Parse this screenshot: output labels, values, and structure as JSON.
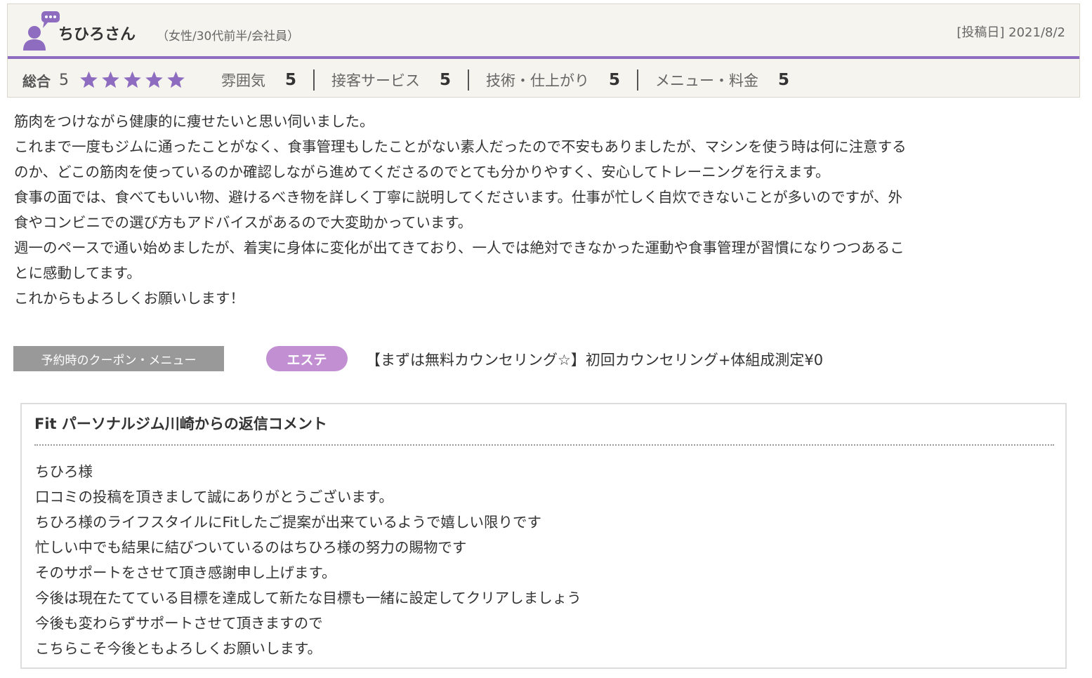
{
  "review": {
    "nickname": "ちひろさん",
    "profile": "（女性/30代前半/会社員）",
    "post_date": "[投稿日] 2021/8/2",
    "overall_label": "総合",
    "overall_value": "5",
    "overall_stars": 5,
    "categories": [
      {
        "label": "雰囲気",
        "value": "5"
      },
      {
        "label": "接客サービス",
        "value": "5"
      },
      {
        "label": "技術・仕上がり",
        "value": "5"
      },
      {
        "label": "メニュー・料金",
        "value": "5"
      }
    ],
    "body_lines": [
      "筋肉をつけながら健康的に痩せたいと思い伺いました。",
      "これまで一度もジムに通ったことがなく、食事管理もしたことがない素人だったので不安もありましたが、マシンを使う時は何に注意する",
      "のか、どこの筋肉を使っているのか確認しながら進めてくださるのでとても分かりやすく、安心してトレーニングを行えます。",
      "食事の面では、食べてもいい物、避けるべき物を詳しく丁寧に説明してくださいます。仕事が忙しく自炊できないことが多いのですが、外",
      "食やコンビニでの選び方もアドバイスがあるので大変助かっています。",
      "週一のペースで通い始めましたが、着実に身体に変化が出てきており、一人では絶対できなかった運動や食事管理が習慣になりつつあるこ",
      "とに感動してます。",
      "これからもよろしくお願いします！"
    ]
  },
  "coupon": {
    "label": "予約時のクーポン・メニュー",
    "genre": "エステ",
    "name": "【まずは無料カウンセリング☆】初回カウンセリング+体組成測定¥0"
  },
  "reply": {
    "title": "Fit パーソナルジム川崎からの返信コメント",
    "lines": [
      "ちひろ様",
      "口コミの投稿を頂きまして誠にありがとうございます。",
      "ちひろ様のライフスタイルにFitしたご提案が出来ているようで嬉しい限りです",
      "忙しい中でも結果に結びついているのはちひろ様の努力の賜物です",
      "そのサポートをさせて頂き感謝申し上げます。",
      "今後は現在たてている目標を達成して新たな目標も一緒に設定してクリアしましょう",
      "今後も変わらずサポートさせて頂きますので",
      "こちらこそ今後ともよろしくお願いします。"
    ]
  },
  "colors": {
    "accent_purple": "#8e6cc0",
    "star_purple": "#8e6cc0",
    "genre_badge": "#c18fd2",
    "header_bg": "#f5f4ee",
    "coupon_label_bg": "#999999"
  },
  "icons": {
    "user": "user-avatar-icon",
    "speech": "speech-bubble-icon",
    "star": "star-icon"
  }
}
